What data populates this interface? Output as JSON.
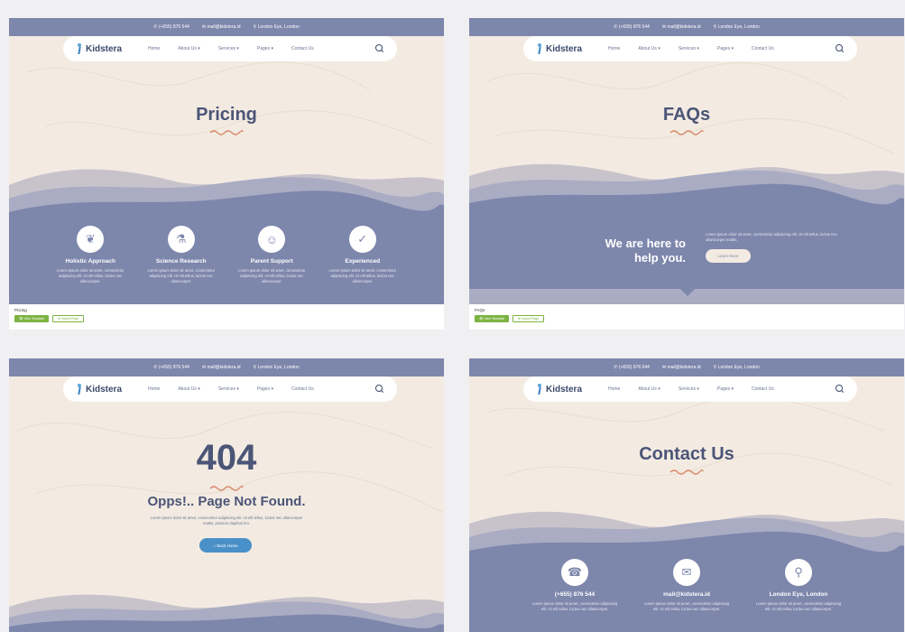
{
  "colors": {
    "header": "#7d86ab",
    "hero_bg": "#f3ebe2",
    "accent_squiggle": "#d98a6a",
    "title": "#4b5577",
    "green": "#7cb342",
    "blue_button": "#4a90c8"
  },
  "topbar": {
    "phone": "(+655) 876 544",
    "email": "mail@kidstera.id",
    "location": "London Eye, London"
  },
  "nav": {
    "logo": "Kidstera",
    "items": [
      "Home",
      "About Us ▾",
      "Services ▾",
      "Pages ▾",
      "Contact Us"
    ],
    "search_icon": "search-icon"
  },
  "pricing": {
    "title": "Pricing",
    "features": [
      {
        "icon": "hand-heart-icon",
        "title": "Holistic Approach",
        "desc": "Lorem ipsum dolor sit amet, consectetur adipiscing elit. Ut elit tellus, luctus nec ullamcorper."
      },
      {
        "icon": "microscope-icon",
        "title": "Science Research",
        "desc": "Lorem ipsum dolor sit amet, consectetur adipiscing elit. Ut elit tellus, luctus nec ullamcorper."
      },
      {
        "icon": "family-icon",
        "title": "Parent Support",
        "desc": "Lorem ipsum dolor sit amet, consectetur adipiscing elit. Ut elit tellus, luctus nec ullamcorper."
      },
      {
        "icon": "thumbs-up-icon",
        "title": "Experienced",
        "desc": "Lorem ipsum dolor sit amet, consectetur adipiscing elit. Ut elit tellus, luctus nec ullamcorper."
      }
    ],
    "caption": "Pricing",
    "view_btn": "View Template",
    "import_btn": "Import Page"
  },
  "faqs": {
    "title": "FAQs",
    "heading_line1": "We are here to",
    "heading_line2": "help you.",
    "desc": "Lorem ipsum dolor sit amet, consectetur adipiscing elit. Ut elit tellus, luctus nec ullamcorper mattis.",
    "button": "Learn More",
    "caption": "FAQs",
    "view_btn": "View Template",
    "import_btn": "Import Page"
  },
  "notfound": {
    "code": "404",
    "title": "Opps!.. Page Not Found.",
    "desc": "Lorem ipsum dolor sit amet, consectetur adipiscing elit. Ut elit tellus, luctus nec ullamcorper mattis, pulvinar dapibus leo.",
    "button": "Back Home"
  },
  "contact": {
    "title": "Contact Us",
    "items": [
      {
        "icon": "phone-icon",
        "title": "(+655) 876 544",
        "desc": "Lorem ipsum dolor sit amet, consectetur adipiscing elit. Ut elit tellus, luctus nec ullamcorper."
      },
      {
        "icon": "mail-icon",
        "title": "mail@kidstera.id",
        "desc": "Lorem ipsum dolor sit amet, consectetur adipiscing elit. Ut elit tellus, luctus nec ullamcorper."
      },
      {
        "icon": "map-icon",
        "title": "London Eye, London",
        "desc": "Lorem ipsum dolor sit amet, consectetur adipiscing elit. Ut elit tellus, luctus nec ullamcorper."
      }
    ]
  }
}
